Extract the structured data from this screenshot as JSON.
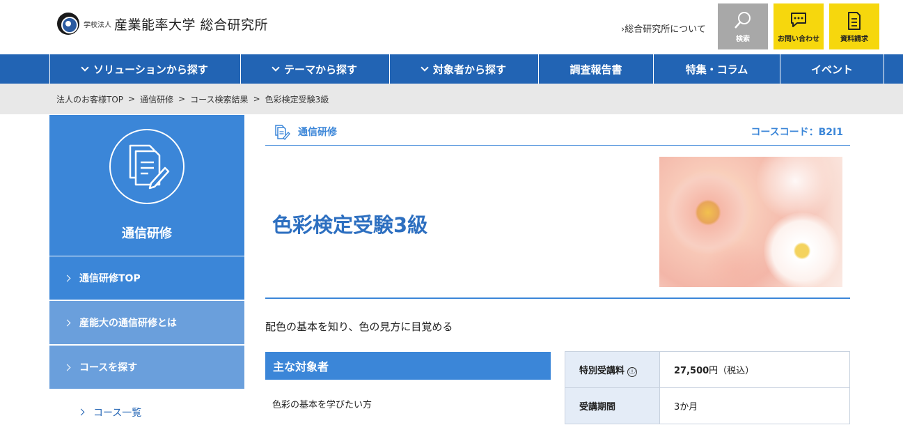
{
  "header": {
    "logo_small": "学校法人",
    "logo_main": "産業能率大学 総合研究所",
    "about_link": "総合研究所について",
    "buttons": [
      {
        "label": "検索",
        "icon": "search-icon"
      },
      {
        "label": "お問い合わせ",
        "icon": "chat-icon"
      },
      {
        "label": "資料請求",
        "icon": "document-icon"
      }
    ]
  },
  "nav": {
    "items": [
      {
        "label": "ソリューションから探す",
        "dropdown": true
      },
      {
        "label": "テーマから探す",
        "dropdown": true
      },
      {
        "label": "対象者から探す",
        "dropdown": true
      },
      {
        "label": "調査報告書",
        "dropdown": false
      },
      {
        "label": "特集・コラム",
        "dropdown": false
      },
      {
        "label": "イベント",
        "dropdown": false
      }
    ]
  },
  "breadcrumb": {
    "items": [
      "法人のお客様TOP",
      "通信研修",
      "コース検索結果",
      "色彩検定受験3級"
    ],
    "separator": ">"
  },
  "sidebar": {
    "title": "通信研修",
    "items": [
      {
        "label": "通信研修TOP"
      },
      {
        "label": "産能大の通信研修とは"
      },
      {
        "label": "コースを探す"
      },
      {
        "label": "コース一覧"
      }
    ]
  },
  "course": {
    "category": "通信研修",
    "code": "コースコード：B2I1",
    "title": "色彩検定受験3級",
    "lead": "配色の基本を知り、色の見方に目覚める",
    "target_heading": "主な対象者",
    "target_text": "色彩の基本を学びたい方"
  },
  "info": {
    "fee_label": "特別受講料",
    "fee_info_icon": "ⓘ",
    "fee_value": "27,500",
    "fee_unit": "円（税込）",
    "period_label": "受講期間",
    "period_value": "3か月"
  },
  "colors": {
    "primary_blue": "#2264b4",
    "accent_blue": "#3b86d8",
    "yellow": "#f6d70d",
    "gray_button": "#a8a8a8"
  }
}
